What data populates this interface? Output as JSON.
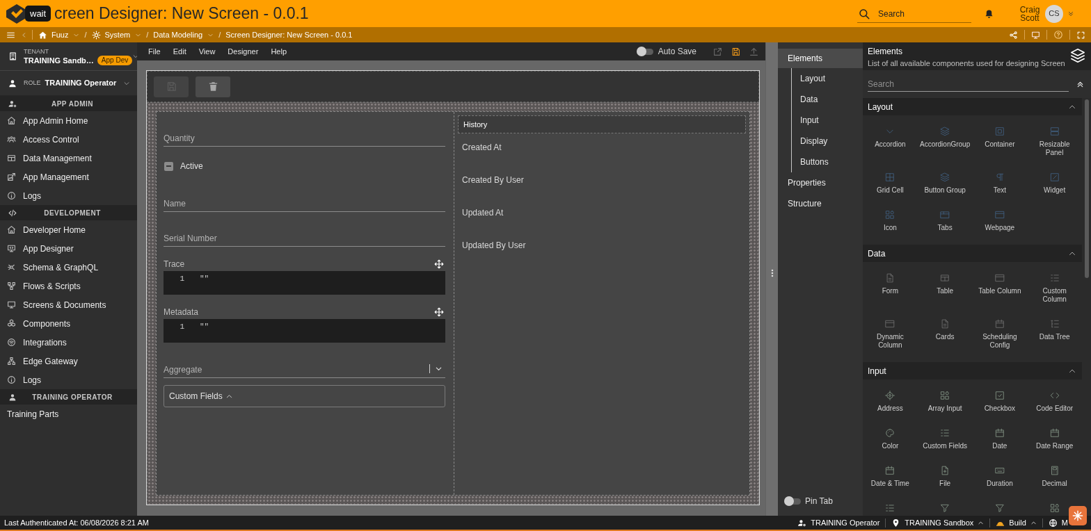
{
  "app_bar": {
    "tooltip": "wait",
    "title": "creen Designer: New Screen - 0.0.1",
    "search": {
      "placeholder": "Search"
    },
    "user": {
      "name": "Craig Scott",
      "initials": "CS"
    }
  },
  "breadcrumbs": [
    {
      "label": "Fuuz",
      "dropdown": true,
      "separator": "/"
    },
    {
      "label": "System",
      "dropdown": true,
      "separator": "/"
    },
    {
      "label": "Data Modeling",
      "dropdown": true,
      "separator": "/"
    },
    {
      "label": "Screen Designer: New Screen - 0.0.1",
      "dropdown": false
    }
  ],
  "sidebar": {
    "tenant": {
      "caption": "TENANT",
      "name": "TRAINING Sandb…",
      "badge": "App Dev"
    },
    "role": {
      "caption": "ROLE",
      "name": "TRAINING Operator"
    },
    "sections": [
      {
        "title": "APP ADMIN",
        "items": [
          "App Admin Home",
          "Access Control",
          "Data Management",
          "App Management",
          "Logs"
        ]
      },
      {
        "title": "DEVELOPMENT",
        "items": [
          "Developer Home",
          "App Designer",
          "Schema & GraphQL",
          "Flows & Scripts",
          "Screens & Documents",
          "Components",
          "Integrations",
          "Edge Gateway",
          "Logs"
        ]
      },
      {
        "title": "TRAINING OPERATOR",
        "items": [
          "Training Parts"
        ]
      }
    ]
  },
  "designer": {
    "menu": [
      "File",
      "Edit",
      "View",
      "Designer",
      "Help"
    ],
    "auto_save": {
      "label": "Auto Save",
      "on": false
    },
    "actions": [
      {
        "kind": "open_external",
        "disabled": true
      },
      {
        "kind": "save",
        "disabled": false
      },
      {
        "kind": "upload",
        "disabled": true
      }
    ],
    "toolbar": [
      {
        "kind": "save",
        "disabled": true
      },
      {
        "kind": "delete",
        "disabled": false
      }
    ],
    "form": [
      {
        "kind": "text",
        "placeholder": "Quantity"
      },
      {
        "kind": "checkbox",
        "label": "Active",
        "indeterminate": true
      },
      {
        "kind": "text",
        "placeholder": "Name"
      },
      {
        "kind": "text",
        "placeholder": "Serial Number"
      },
      {
        "kind": "code",
        "label": "Trace",
        "line": "1",
        "value": "\"\""
      },
      {
        "kind": "code",
        "label": "Metadata",
        "line": "1",
        "value": "\"\""
      },
      {
        "kind": "select",
        "placeholder": "Aggregate"
      },
      {
        "kind": "group",
        "label": "Custom Fields",
        "expanded": true
      }
    ],
    "history": {
      "title": "History",
      "fields": [
        "Created At",
        "Created By User",
        "Updated At",
        "Updated By User"
      ]
    }
  },
  "side_nav": {
    "items": [
      {
        "label": "Elements",
        "selected": true,
        "children": [
          {
            "label": "Layout",
            "selected": false
          },
          {
            "label": "Data",
            "selected": false
          },
          {
            "label": "Input",
            "selected": false
          },
          {
            "label": "Display",
            "selected": false
          },
          {
            "label": "Buttons",
            "selected": false
          }
        ]
      },
      {
        "label": "Properties",
        "selected": false
      },
      {
        "label": "Structure",
        "selected": false
      }
    ],
    "pin_tab": {
      "label": "Pin Tab",
      "on": false
    }
  },
  "elements_panel": {
    "title": "Elements",
    "description": "List of all available components used for designing Screen",
    "search": {
      "placeholder": "Search"
    },
    "sections": [
      {
        "title": "Layout",
        "expanded": true,
        "items": [
          {
            "label": "Accordion"
          },
          {
            "label": "AccordionGroup"
          },
          {
            "label": "Container"
          },
          {
            "label": "Resizable Panel"
          },
          {
            "label": "Grid Cell"
          },
          {
            "label": "Button Group"
          },
          {
            "label": "Text"
          },
          {
            "label": "Widget"
          },
          {
            "label": "Icon"
          },
          {
            "label": "Tabs"
          },
          {
            "label": "Webpage"
          }
        ]
      },
      {
        "title": "Data",
        "expanded": true,
        "items": [
          {
            "label": "Form"
          },
          {
            "label": "Table"
          },
          {
            "label": "Table Column"
          },
          {
            "label": "Custom Column"
          },
          {
            "label": "Dynamic Column"
          },
          {
            "label": "Cards"
          },
          {
            "label": "Scheduling Config"
          },
          {
            "label": "Data Tree"
          }
        ]
      },
      {
        "title": "Input",
        "expanded": true,
        "items": [
          {
            "kind": "tile",
            "label": "Address"
          },
          {
            "kind": "tile",
            "label": "Array Input"
          },
          {
            "kind": "tile",
            "label": "Checkbox"
          },
          {
            "kind": "tile",
            "label": "Code Editor"
          },
          {
            "kind": "tile",
            "label": "Color"
          },
          {
            "kind": "tile",
            "label": "Custom Fields"
          },
          {
            "kind": "tile",
            "label": "Date"
          },
          {
            "kind": "tile",
            "label": "Date Range"
          },
          {
            "kind": "tile",
            "label": "Date & Time"
          },
          {
            "kind": "tile",
            "label": "File"
          },
          {
            "kind": "tile",
            "label": "Duration"
          },
          {
            "kind": "tile",
            "label": "Decimal"
          },
          {
            "kind": "clipped"
          },
          {
            "kind": "clipped"
          },
          {
            "kind": "clipped"
          },
          {
            "kind": "clipped"
          }
        ]
      }
    ]
  },
  "status_bar": {
    "last_authenticated": "Last Authenticated At: 06/08/2026 8:21 AM",
    "items": [
      {
        "label": "TRAINING Operator",
        "dropdown": false
      },
      {
        "label": "TRAINING Sandbox",
        "dropdown": true
      },
      {
        "label": "Build",
        "dropdown": true
      },
      {
        "label": "M",
        "dropdown": false
      }
    ]
  }
}
